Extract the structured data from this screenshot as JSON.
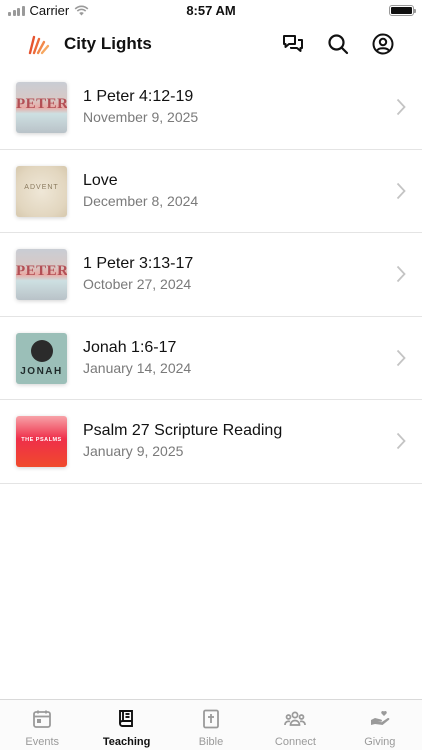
{
  "status_bar": {
    "carrier": "Carrier",
    "time": "8:57 AM"
  },
  "header": {
    "title": "City Lights",
    "icons": [
      "chat-bubbles-icon",
      "search-icon",
      "profile-icon"
    ]
  },
  "teachings": [
    {
      "title": "1 Peter 4:12-19",
      "date": "November 9, 2025",
      "thumb_text": "PETER",
      "thumb_style": "peter"
    },
    {
      "title": "Love",
      "date": "December 8, 2024",
      "thumb_text": "ADVENT",
      "thumb_style": "advent"
    },
    {
      "title": "1 Peter 3:13-17",
      "date": "October 27, 2024",
      "thumb_text": "PETER",
      "thumb_style": "peter"
    },
    {
      "title": "Jonah 1:6-17",
      "date": "January 14, 2024",
      "thumb_text": "JONAH",
      "thumb_style": "jonah"
    },
    {
      "title": "Psalm 27 Scripture Reading",
      "date": "January 9, 2025",
      "thumb_text": "THE PSALMS",
      "thumb_style": "psalm"
    }
  ],
  "tab_bar": {
    "active": "Teaching",
    "tabs": [
      {
        "label": "Events",
        "icon": "calendar-icon"
      },
      {
        "label": "Teaching",
        "icon": "book-icon"
      },
      {
        "label": "Bible",
        "icon": "bible-icon"
      },
      {
        "label": "Connect",
        "icon": "people-icon"
      },
      {
        "label": "Giving",
        "icon": "giving-hand-icon"
      }
    ]
  },
  "colors": {
    "brand_accent": "#e5532f",
    "inactive_tab": "#9a9a9a",
    "divider": "#e4e4e4"
  }
}
